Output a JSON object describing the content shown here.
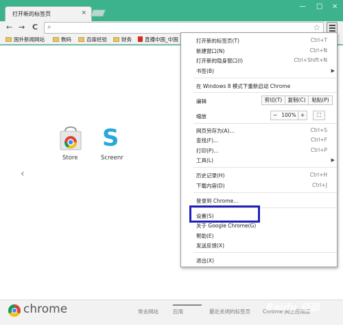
{
  "window": {
    "tab_title": "打开新的标签页",
    "tab_close": "×",
    "minimize": "—",
    "maximize": "□",
    "close": "×"
  },
  "toolbar": {
    "back": "←",
    "forward": "→",
    "reload": "C",
    "search_icon": "search-icon",
    "url_value": "",
    "star_icon": "star-icon"
  },
  "bookmarks": [
    {
      "label": "国外新闻网站"
    },
    {
      "label": "数码"
    },
    {
      "label": "百度经验"
    },
    {
      "label": "财务"
    },
    {
      "label": "直播中国_中国"
    }
  ],
  "newtab": {
    "apps": [
      {
        "label": "Store"
      },
      {
        "label": "Screenr"
      }
    ],
    "left_arrow": "‹"
  },
  "bottom_bar": {
    "logo_text": "chrome",
    "tabs": [
      {
        "label": "常去网站"
      },
      {
        "label": "应用"
      },
      {
        "label": "最近关闭的标签页"
      },
      {
        "label": "Chrome 网上应用店"
      }
    ]
  },
  "menu": {
    "new_tab": {
      "label": "打开新的标签页(T)",
      "shortcut": "Ctrl+T"
    },
    "new_window": {
      "label": "新建窗口(N)",
      "shortcut": "Ctrl+N"
    },
    "incognito": {
      "label": "打开新的隐身窗口(I)",
      "shortcut": "Ctrl+Shift+N"
    },
    "bookmarks": {
      "label": "书签(B)"
    },
    "win8": {
      "label": "在 Windows 8 模式下重新启动 Chrome"
    },
    "edit": {
      "label": "编辑",
      "cut": "剪切(T)",
      "copy": "复制(C)",
      "paste": "粘贴(P)"
    },
    "zoom": {
      "label": "缩放",
      "minus": "−",
      "value": "100%",
      "plus": "+",
      "fullscreen": "⛶"
    },
    "save_as": {
      "label": "网页另存为(A)...",
      "shortcut": "Ctrl+S"
    },
    "find": {
      "label": "查找(F)...",
      "shortcut": "Ctrl+F"
    },
    "print": {
      "label": "打印(P)...",
      "shortcut": "Ctrl+P"
    },
    "tools": {
      "label": "工具(L)"
    },
    "history": {
      "label": "历史记录(H)",
      "shortcut": "Ctrl+H"
    },
    "downloads": {
      "label": "下载内容(D)",
      "shortcut": "Ctrl+J"
    },
    "signin": {
      "label": "登录到 Chrome..."
    },
    "settings": {
      "label": "设置(S)"
    },
    "about": {
      "label": "关于 Google Chrome(G)"
    },
    "help": {
      "label": "帮助(E)"
    },
    "feedback": {
      "label": "发送反馈(X)"
    },
    "exit": {
      "label": "退出(X)"
    }
  },
  "watermark": "Baidu 经验",
  "colors": {
    "frame": "#2aa784",
    "highlight_box": "#1f1fbd"
  }
}
